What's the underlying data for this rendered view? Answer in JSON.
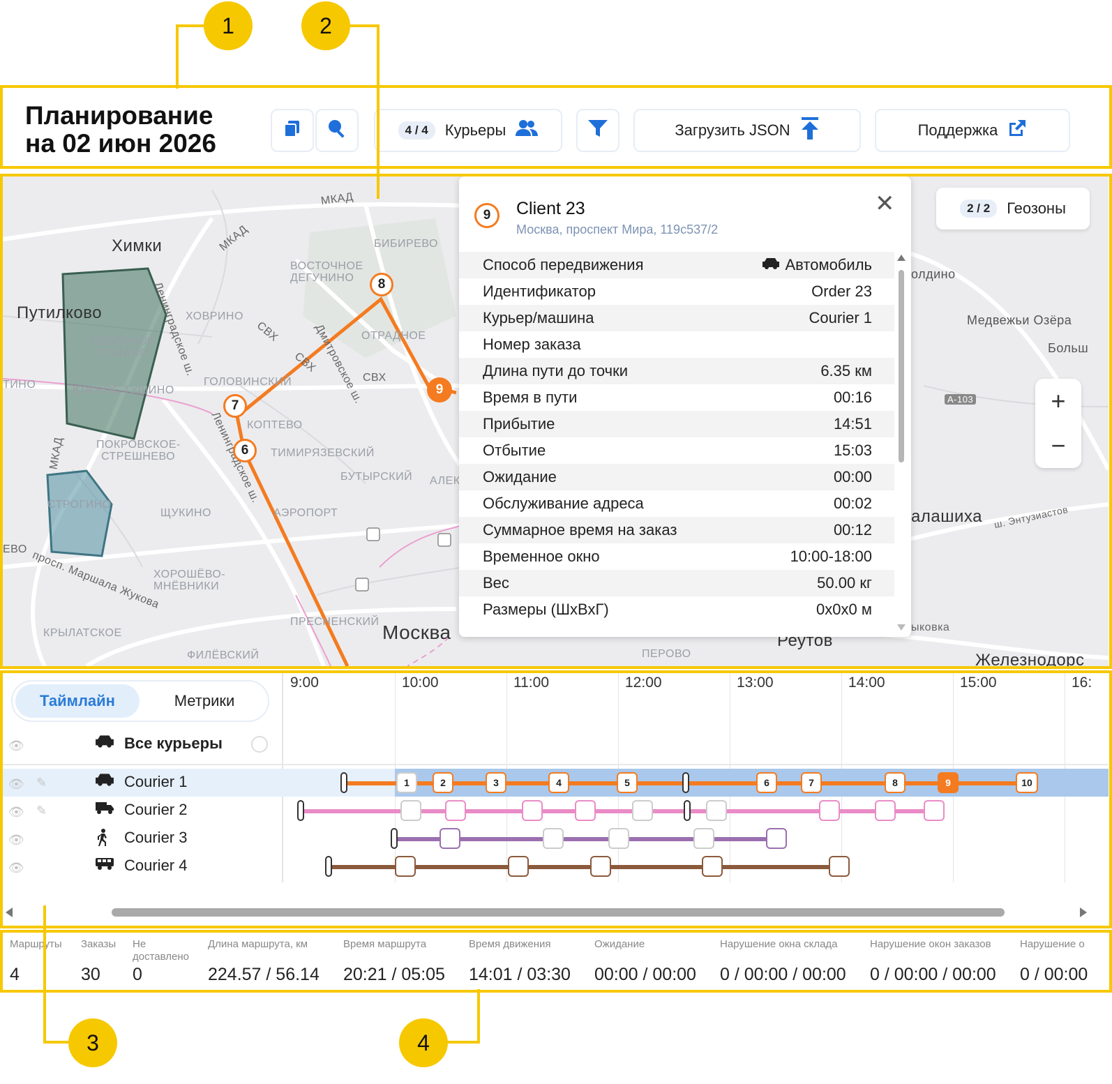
{
  "callouts": [
    "1",
    "2",
    "3",
    "4"
  ],
  "header": {
    "title_line1": "Планирование",
    "title_line2": "на 02 июн 2026",
    "couriers_badge": "4 / 4",
    "couriers_label": "Курьеры",
    "upload_label": "Загрузить JSON",
    "support_label": "Поддержка"
  },
  "map": {
    "geozones_badge": "2 / 2",
    "geozones_label": "Геозоны",
    "zoom_in": "+",
    "zoom_out": "−",
    "labels": {
      "khimki": "Химки",
      "putilkovo": "Путилково",
      "moskva": "Москва",
      "reutov": "Реутов",
      "balashikha": "алашиха",
      "zheleznodor": "Железнодорс",
      "medvezhi": "Медвежьи Озёра",
      "bolsh": "Больш",
      "oldino": "олдино",
      "mkad1": "МКАД",
      "mkad2": "МКАД",
      "mkad3": "МКАД",
      "bibirevo": "БИБИРЕВО",
      "vostochnoe": "ВОСТОЧНОЕ ДЕГУНИНО",
      "khovrino": "ХОВРИНО",
      "svkh1": "СВХ",
      "svkh2": "СВХ",
      "svkh3": "СВХ",
      "severnoe": "СЕВЕРНОЕ ТУШИНО",
      "yuzhnoe": "ЮЖНОЕ ТУШИНО",
      "tino": "ТИНО",
      "golovinsky": "ГОЛОВИНСКИЙ",
      "otradnoe": "ОТРАДНОЕ",
      "koptevo": "КОПТЕВО",
      "timiryazev": "ТИМИРЯЗЕВСКИЙ",
      "butyrsky": "БУТЫРСКИЙ",
      "alek": "АЛЕК",
      "pokrovskoe": "ПОКРОВСКОЕ-СТРЕШНЕВО",
      "strogino": "СТРОГИНО",
      "shchukino": "ЩУКИНО",
      "aeroport": "АЭРОПОРТ",
      "khoroshevo": "ХОРОШЁВО-МНЁВНИКИ",
      "presnensky": "ПРЕСНЕНСКИЙ",
      "krylatskoe": "КРЫЛАТСКОЕ",
      "filevsky": "ФИЛЁВСКИЙ",
      "perovo": "ПЕРОВО",
      "vykhovka": "ыковка",
      "leningrad1": "Ленинградское ш.",
      "leningrad2": "Ленинградское ш.",
      "dmitrov": "Дмитровское ш.",
      "zhukova": "просп. Маршала Жукова",
      "entuziastov": "ш. Энтузиастов",
      "a103": "А-103",
      "evo": "ЕВО"
    },
    "markers": [
      "6",
      "7",
      "8",
      "9"
    ]
  },
  "popup": {
    "pin_number": "9",
    "title": "Client 23",
    "address": "Москва, проспект Мира, 119с537/2",
    "close": "✕",
    "rows": [
      {
        "label": "Способ передвижения",
        "value": "Автомобиль"
      },
      {
        "label": "Идентификатор",
        "value": "Order 23"
      },
      {
        "label": "Курьер/машина",
        "value": "Courier 1"
      },
      {
        "label": "Номер заказа",
        "value": ""
      },
      {
        "label": "Длина пути до точки",
        "value": "6.35 км"
      },
      {
        "label": "Время в пути",
        "value": "00:16"
      },
      {
        "label": "Прибытие",
        "value": "14:51"
      },
      {
        "label": "Отбытие",
        "value": "15:03"
      },
      {
        "label": "Ожидание",
        "value": "00:00"
      },
      {
        "label": "Обслуживание адреса",
        "value": "00:02"
      },
      {
        "label": "Суммарное время на заказ",
        "value": "00:12"
      },
      {
        "label": "Временное окно",
        "value": "10:00-18:00"
      },
      {
        "label": "Вес",
        "value": "50.00 кг"
      },
      {
        "label": "Размеры (ШхВхГ)",
        "value": "0x0x0 м"
      }
    ]
  },
  "timeline": {
    "tab_timeline": "Таймлайн",
    "tab_metrics": "Метрики",
    "all_couriers": "Все курьеры",
    "hours": [
      "9:00",
      "10:00",
      "11:00",
      "12:00",
      "13:00",
      "14:00",
      "15:00",
      "16:"
    ],
    "couriers": [
      {
        "name": "Courier 1",
        "color": "#f47b20",
        "stops": [
          "1",
          "2",
          "3",
          "4",
          "5",
          "6",
          "7",
          "8",
          "9",
          "10"
        ]
      },
      {
        "name": "Courier 2",
        "color": "#e98cc7"
      },
      {
        "name": "Courier 3",
        "color": "#9b6fb0"
      },
      {
        "name": "Courier 4",
        "color": "#8b5a3c"
      }
    ]
  },
  "metrics": [
    {
      "label": "Маршруты",
      "value": "4"
    },
    {
      "label": "Заказы",
      "value": "30"
    },
    {
      "label": "Не доставлено",
      "value": "0"
    },
    {
      "label": "Длина маршрута, км",
      "value": "224.57 / 56.14"
    },
    {
      "label": "Время маршрута",
      "value": "20:21 / 05:05"
    },
    {
      "label": "Время движения",
      "value": "14:01 / 03:30"
    },
    {
      "label": "Ожидание",
      "value": "00:00 / 00:00"
    },
    {
      "label": "Нарушение окна склада",
      "value": "0 / 00:00 / 00:00"
    },
    {
      "label": "Нарушение окон заказов",
      "value": "0 / 00:00 / 00:00"
    },
    {
      "label": "Нарушение о",
      "value": "0 / 00:00"
    }
  ],
  "colors": {
    "accent": "#f6c800",
    "route1": "#f47b20",
    "blue": "#2a7bd6"
  }
}
